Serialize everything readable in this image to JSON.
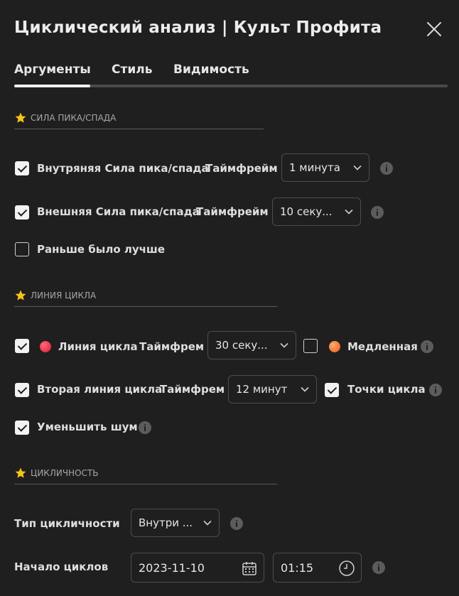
{
  "dialog": {
    "title": "Циклический анализ | Культ Профита"
  },
  "tabs": [
    {
      "label": "Аргументы",
      "active": true
    },
    {
      "label": "Стиль",
      "active": false
    },
    {
      "label": "Видимость",
      "active": false
    }
  ],
  "sections": {
    "peak": {
      "title": "Сила пика/спада",
      "inner": {
        "checked": true,
        "label": "Внутряняя Сила пика/спада",
        "tf_label": "Таймфрейм",
        "tf_value": "1 минута"
      },
      "outer": {
        "checked": true,
        "label": "Внешняя Сила пика/спада",
        "tf_label": "Таймфрейм",
        "tf_value": "10 секу..."
      },
      "earlier": {
        "checked": false,
        "label": "Раньше было лучше"
      }
    },
    "cycle_line": {
      "title": "Линия цикла",
      "line": {
        "checked": true,
        "color": "#e8394f",
        "label": "Линия цикла",
        "tf_label": "Таймфрем",
        "tf_value": "30 секу..."
      },
      "slow": {
        "checked": false,
        "color": "#f07a3c",
        "label": "Медленная"
      },
      "second": {
        "checked": true,
        "label": "Вторая линия цикла",
        "tf_label": "Таймфрем",
        "tf_value": "12 минут"
      },
      "points": {
        "checked": true,
        "label": "Точки цикла"
      },
      "noise": {
        "checked": true,
        "label": "Уменьшить шум"
      }
    },
    "cyclicity": {
      "title": "Цикличность",
      "type": {
        "label": "Тип цикличности",
        "value": "Внутри ..."
      },
      "start": {
        "label": "Начало циклов",
        "date": "2023-11-10",
        "time": "01:15"
      }
    }
  },
  "colors": {
    "background": "#1f1f1f",
    "star": "#f5c518",
    "accent": "#f2f2f2"
  },
  "icons": {
    "close": "close-icon",
    "star": "star-icon",
    "chevron": "chevron-down-icon",
    "info": "info-icon",
    "calendar": "calendar-icon",
    "clock": "clock-icon"
  }
}
